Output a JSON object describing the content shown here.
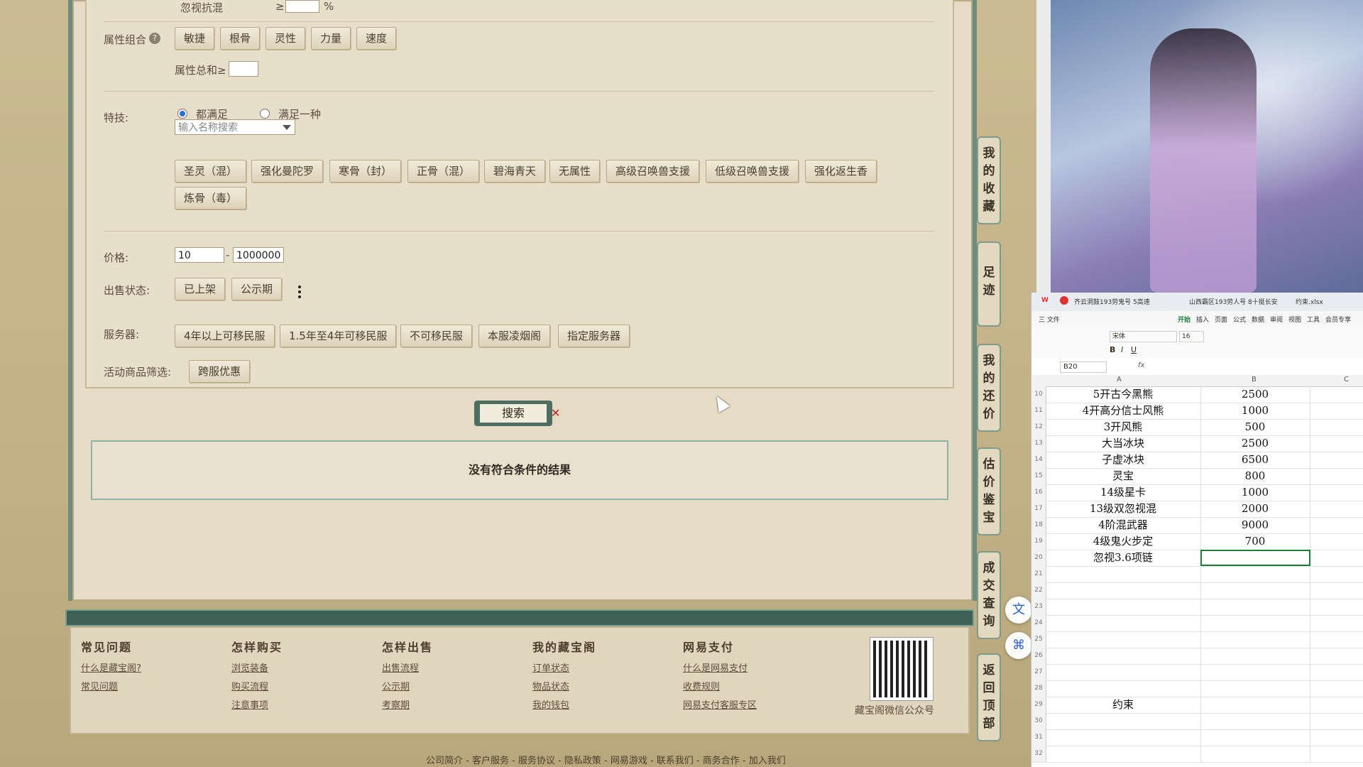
{
  "filters": {
    "ignore_resist_label": "忽视抗混",
    "ignore_resist_op": "≥",
    "ignore_resist_unit": "%",
    "attr_combo_label": "属性组合",
    "attr_buttons": [
      "敏捷",
      "根骨",
      "灵性",
      "力量",
      "速度"
    ],
    "attr_sum_label": "属性总和≥",
    "skill_label": "特技:",
    "radio_all": "都满足",
    "radio_any": "满足一种",
    "skill_search_placeholder": "输入名称搜索",
    "skill_buttons": [
      "圣灵（混）",
      "强化曼陀罗",
      "寒骨（封）",
      "正骨（混）",
      "碧海青天",
      "无属性",
      "高级召唤兽支援",
      "低级召唤兽支援",
      "强化返生香",
      "炼骨（毒）"
    ],
    "price_label": "价格:",
    "price_min": "10",
    "price_max": "1000000",
    "price_dash": "-",
    "sale_status_label": "出售状态:",
    "sale_status_buttons": [
      "已上架",
      "公示期"
    ],
    "server_label": "服务器:",
    "server_buttons": [
      "4年以上可移民服",
      "1.5年至4年可移民服",
      "不可移民服",
      "本服凌烟阁",
      "指定服务器"
    ],
    "activity_label": "活动商品筛选:",
    "activity_buttons": [
      "跨服优惠"
    ]
  },
  "search_button": "搜索",
  "no_result_text": "没有符合条件的结果",
  "side_tabs": [
    "我的收藏",
    "足迹",
    "我的还价",
    "估价鉴宝",
    "成交查询",
    "返回顶部"
  ],
  "footer": {
    "columns": [
      {
        "title": "常见问题",
        "links": [
          "什么是藏宝阁?",
          "常见问题"
        ]
      },
      {
        "title": "怎样购买",
        "links": [
          "浏览装备",
          "购买流程",
          "注意事项"
        ]
      },
      {
        "title": "怎样出售",
        "links": [
          "出售流程",
          "公示期",
          "考察期"
        ]
      },
      {
        "title": "我的藏宝阁",
        "links": [
          "订单状态",
          "物品状态",
          "我的钱包"
        ]
      },
      {
        "title": "网易支付",
        "links": [
          "什么是网易支付",
          "收费规则",
          "网易支付客服专区"
        ]
      }
    ],
    "qr_caption": "藏宝阁微信公众号",
    "bottom_links": "公司简介 - 客户服务 - 服务协议 - 隐私政策 - 网易游戏 - 联系我们 - 商务合作 - 加入我们"
  },
  "excel": {
    "tabs": [
      "齐云洞鼓193劳鬼号 5高速",
      "山西霸区193劳人号 8十挺长安",
      "约束.xlsx"
    ],
    "menu": [
      "三 文件",
      "开始",
      "插入",
      "页面",
      "公式",
      "数据",
      "审阅",
      "视图",
      "工具",
      "会员专享"
    ],
    "font_name": "宋体",
    "font_size": "16",
    "cell_ref": "B20",
    "fx": "fx",
    "col_headers": [
      "A",
      "B",
      "C"
    ],
    "rows": [
      {
        "n": "10",
        "a": "5开古今黑熊",
        "b": "2500"
      },
      {
        "n": "11",
        "a": "4开高分信士风熊",
        "b": "1000"
      },
      {
        "n": "12",
        "a": "3开风熊",
        "b": "500"
      },
      {
        "n": "13",
        "a": "大当冰块",
        "b": "2500"
      },
      {
        "n": "14",
        "a": "子虚冰块",
        "b": "6500"
      },
      {
        "n": "15",
        "a": "灵宝",
        "b": "800"
      },
      {
        "n": "16",
        "a": "14级星卡",
        "b": "1000"
      },
      {
        "n": "17",
        "a": "13级双忽视混",
        "b": "2000"
      },
      {
        "n": "18",
        "a": "4阶混武器",
        "b": "9000"
      },
      {
        "n": "19",
        "a": "4级鬼火步定",
        "b": "700"
      },
      {
        "n": "20",
        "a": "忽视3.6项链",
        "b": ""
      },
      {
        "n": "21",
        "a": "",
        "b": ""
      },
      {
        "n": "22",
        "a": "",
        "b": ""
      },
      {
        "n": "23",
        "a": "",
        "b": ""
      },
      {
        "n": "24",
        "a": "",
        "b": ""
      },
      {
        "n": "25",
        "a": "",
        "b": ""
      },
      {
        "n": "26",
        "a": "",
        "b": ""
      },
      {
        "n": "27",
        "a": "",
        "b": ""
      },
      {
        "n": "28",
        "a": "",
        "b": ""
      },
      {
        "n": "29",
        "a": "约束",
        "b": ""
      },
      {
        "n": "30",
        "a": "",
        "b": ""
      },
      {
        "n": "31",
        "a": "",
        "b": ""
      },
      {
        "n": "32",
        "a": "",
        "b": ""
      }
    ]
  },
  "fab_icons": [
    "translate-icon",
    "network-icon"
  ],
  "colors": {
    "accent_green": "#3e6055",
    "panel_bg": "#e6dcc6",
    "radio_blue": "#2d6cd3"
  }
}
